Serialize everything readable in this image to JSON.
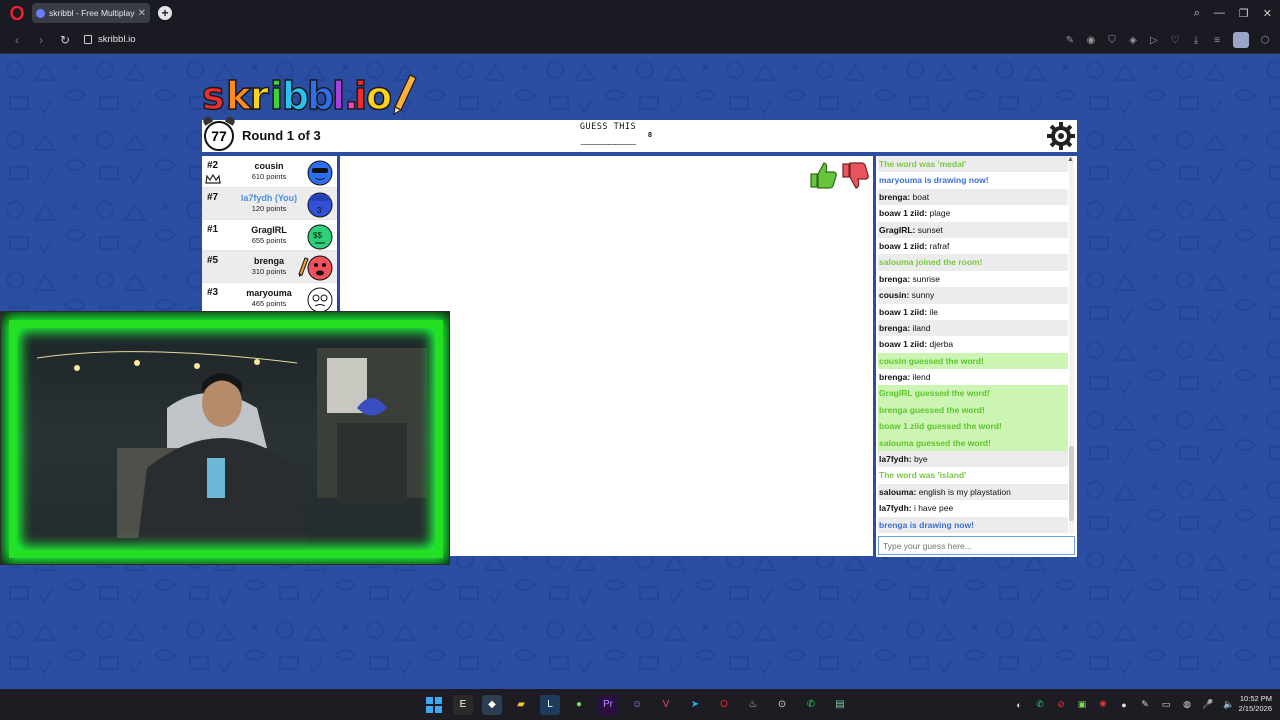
{
  "browser": {
    "tab_title": "skribbl - Free Multiplayer",
    "url": "skribbl.io"
  },
  "game": {
    "logo_text": "skribbl.io",
    "timer": "77",
    "round_text": "Round 1 of 3",
    "guess_label": "GUESS THIS",
    "word_blanks": "________",
    "word_length": "8"
  },
  "players": [
    {
      "rank": "#2",
      "name": "cousin",
      "points": "610 points",
      "color": "#2e6ff0",
      "you": false
    },
    {
      "rank": "#7",
      "name": "la7fydh (You)",
      "points": "120 points",
      "color": "#3050d8",
      "you": true
    },
    {
      "rank": "#1",
      "name": "GragIRL",
      "points": "655 points",
      "color": "#2fd07a",
      "you": false
    },
    {
      "rank": "#5",
      "name": "brenga",
      "points": "310 points",
      "color": "#f0505a",
      "you": false
    },
    {
      "rank": "#3",
      "name": "maryouma",
      "points": "465 points",
      "color": "#ffffff",
      "you": false
    }
  ],
  "chat": {
    "messages": [
      {
        "type": "sys-green",
        "text": "The word was 'medal'"
      },
      {
        "type": "sys-blue",
        "text": "maryouma is drawing now!"
      },
      {
        "type": "user",
        "user": "brenga:",
        "text": " boat"
      },
      {
        "type": "user",
        "user": "boaw 1 ziid:",
        "text": " plage"
      },
      {
        "type": "user",
        "user": "GragIRL:",
        "text": " sunset"
      },
      {
        "type": "user",
        "user": "boaw 1 ziid:",
        "text": " rafraf"
      },
      {
        "type": "sys-green",
        "text": "salouma joined the room!"
      },
      {
        "type": "user",
        "user": "brenga:",
        "text": " sunrise"
      },
      {
        "type": "user",
        "user": "cousin:",
        "text": " sunny"
      },
      {
        "type": "user",
        "user": "boaw 1 ziid:",
        "text": " ile"
      },
      {
        "type": "user",
        "user": "brenga:",
        "text": " iland"
      },
      {
        "type": "user",
        "user": "boaw 1 ziid:",
        "text": " djerba"
      },
      {
        "type": "guessed",
        "text": "cousin guessed the word!"
      },
      {
        "type": "user",
        "user": "brenga:",
        "text": " ilend"
      },
      {
        "type": "guessed",
        "text": "GragIRL guessed the word!"
      },
      {
        "type": "guessed",
        "text": "brenga guessed the word!"
      },
      {
        "type": "guessed",
        "text": "boaw 1 ziid guessed the word!"
      },
      {
        "type": "guessed",
        "text": "salouma guessed the word!"
      },
      {
        "type": "user",
        "user": "la7fydh:",
        "text": " bye"
      },
      {
        "type": "sys-green",
        "text": "The word was 'island'"
      },
      {
        "type": "user",
        "user": "salouma:",
        "text": " english is my playstation"
      },
      {
        "type": "user",
        "user": "la7fydh:",
        "text": " i have pee"
      },
      {
        "type": "sys-blue",
        "text": "brenga is drawing now!"
      }
    ],
    "input_placeholder": "Type your guess here..."
  },
  "taskbar": {
    "time": "10:52 PM",
    "date": "2/15/2026"
  },
  "colors": {
    "page_bg": "#2b4ea3",
    "chat_green": "#7ac83f",
    "chat_blue": "#3b6fd6",
    "guessed_bg": "#ccf5b3",
    "webcam_glow": "#23e022"
  }
}
